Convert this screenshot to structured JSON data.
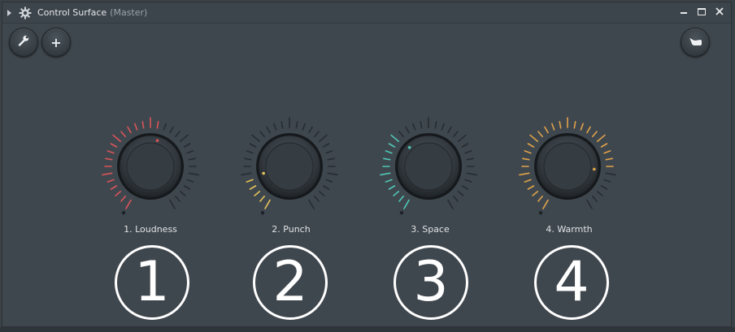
{
  "window": {
    "title": "Control Surface",
    "subtitle": "(Master)",
    "controls": [
      "minimize-icon",
      "maximize-icon",
      "close-icon"
    ]
  },
  "toolbar": {
    "left_buttons": [
      {
        "icon": "wrench-icon",
        "glyph": ""
      },
      {
        "icon": "plus-icon",
        "glyph": "+"
      }
    ],
    "right_button": {
      "icon": "hand-pointer-icon"
    }
  },
  "knobs": [
    {
      "label": "1. Loudness",
      "value": 0.55,
      "color": "#d9545a"
    },
    {
      "label": "2. Punch",
      "value": 0.15,
      "color": "#e6c35a"
    },
    {
      "label": "3. Space",
      "value": 0.35,
      "color": "#4fc6b4"
    },
    {
      "label": "4. Warmth",
      "value": 0.82,
      "color": "#e0a349"
    }
  ],
  "numbers": [
    "1",
    "2",
    "3",
    "4"
  ],
  "colors": {
    "bg": "#3f474e",
    "tick_off": "#262c31"
  }
}
